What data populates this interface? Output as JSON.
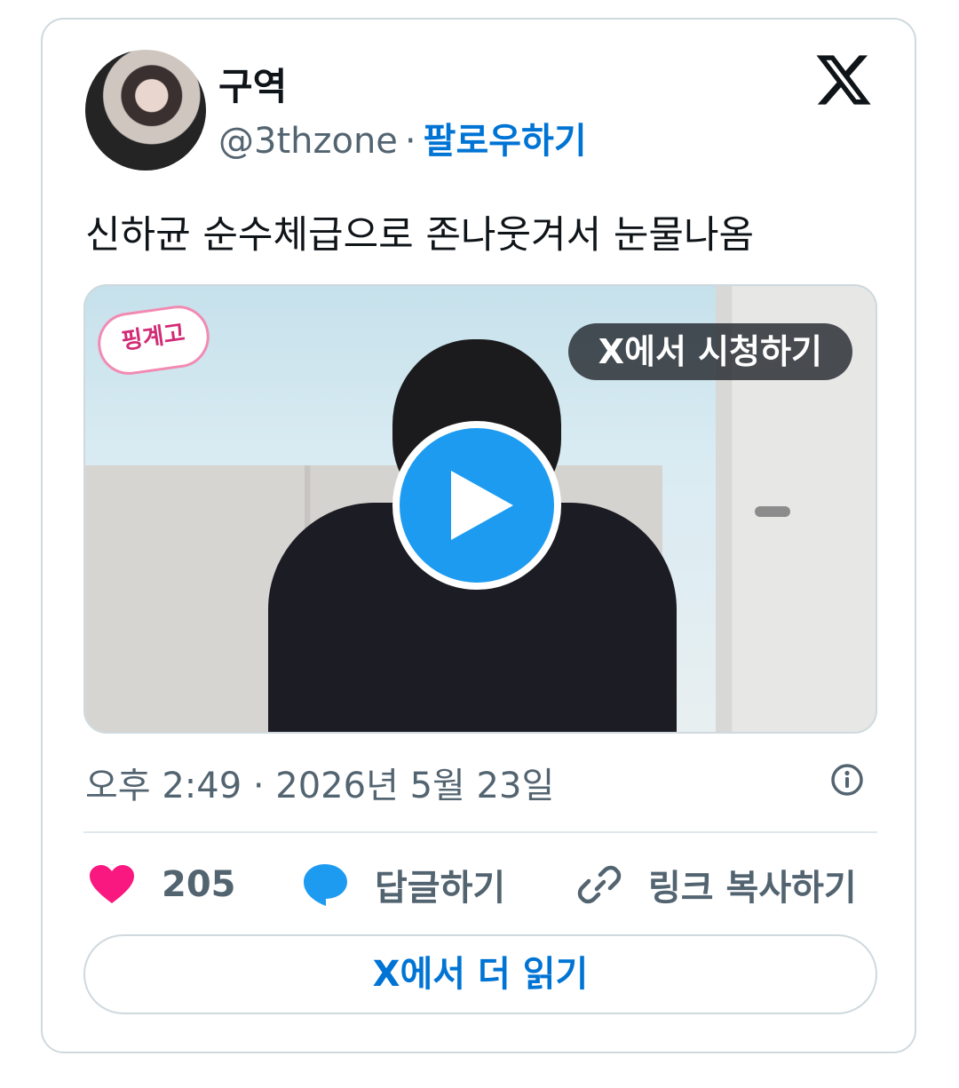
{
  "author": {
    "name": "구역",
    "handle": "@3thzone",
    "separator": "·",
    "follow_label": "팔로우하기"
  },
  "tweet": {
    "text": "신하균 순수체급으로 존나웃겨서 눈물나옴"
  },
  "media": {
    "watch_label": "X에서 시청하기",
    "sticker_text": "핑계고"
  },
  "meta": {
    "timestamp": "오후 2:49 · 2026년 5월 23일"
  },
  "actions": {
    "like_count": "205",
    "reply_label": "답글하기",
    "copy_link_label": "링크 복사하기"
  },
  "read_more_label": "X에서 더 읽기",
  "colors": {
    "like": "#f91880",
    "reply": "#1d9bf0",
    "link_blue": "#0074d4",
    "muted": "#536471"
  }
}
